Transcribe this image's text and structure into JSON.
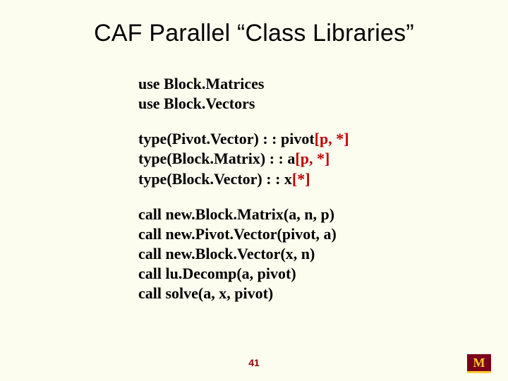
{
  "title": "CAF Parallel “Class Libraries”",
  "block1": {
    "l1": "use Block.Matrices",
    "l2": "use Block.Vectors"
  },
  "block2": {
    "l1a": "type(Pivot.Vector) : : pivot",
    "l1b": "[p, *]",
    "l2a": "type(Block.Matrix) : : a",
    "l2b": "[p, *]",
    "l3a": "type(Block.Vector) : : x",
    "l3b": "[*]"
  },
  "block3": {
    "l1": "call new.Block.Matrix(a, n, p)",
    "l2": "call new.Pivot.Vector(pivot, a)",
    "l3": "call new.Block.Vector(x, n)",
    "l4": "call lu.Decomp(a, pivot)",
    "l5": "call solve(a, x, pivot)"
  },
  "pagenum": "41",
  "logo_letter": "M"
}
